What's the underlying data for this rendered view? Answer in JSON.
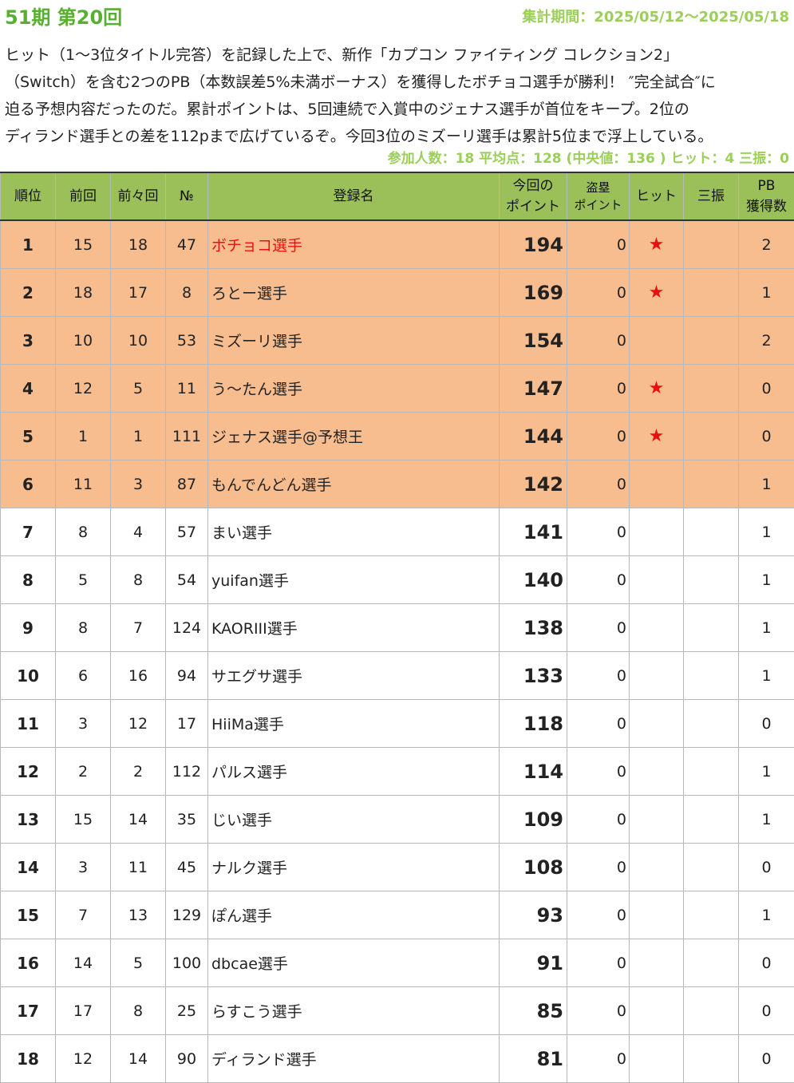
{
  "header": {
    "title": "51期 第20回",
    "period": "集計期間：2025/05/12～2025/05/18"
  },
  "description": "ヒット（1～3位タイトル完答）を記録した上で、新作「カプコン ファイティング コレクション2」\n（Switch）を含む2つのPB（本数誤差5%未満ボーナス）を獲得したボチョコ選手が勝利！ ″完全試合″に\n迫る予想内容だったのだ。累計ポイントは、5回連続で入賞中のジェナス選手が首位をキープ。2位の\nディランド選手との差を112pまで広げているぞ。今回3位のミズーリ選手は累計5位まで浮上している。",
  "stats": "参加人数：18 平均点：128 (中央値：136 ) ヒット：4 三振：0",
  "table": {
    "headers": {
      "rank": "順位",
      "prev": "前回",
      "prev2": "前々回",
      "no": "№",
      "name": "登録名",
      "points_line1": "今回の",
      "points_line2": "ポイント",
      "steal_line1": "盗塁",
      "steal_line2": "ポイント",
      "hit": "ヒット",
      "strikeout": "三振",
      "pb_line1": "PB",
      "pb_line2": "獲得数"
    },
    "hit_mark": "★",
    "highlight_color": "#f8bd8e",
    "header_color": "#9bc05a",
    "rows": [
      {
        "rank": "1",
        "prev": "15",
        "prev2": "18",
        "no": "47",
        "name": "ボチョコ選手",
        "points": "194",
        "steal": "0",
        "hit": "★",
        "strikeout": "",
        "pb": "2"
      },
      {
        "rank": "2",
        "prev": "18",
        "prev2": "17",
        "no": "8",
        "name": "ろとー選手",
        "points": "169",
        "steal": "0",
        "hit": "★",
        "strikeout": "",
        "pb": "1"
      },
      {
        "rank": "3",
        "prev": "10",
        "prev2": "10",
        "no": "53",
        "name": "ミズーリ選手",
        "points": "154",
        "steal": "0",
        "hit": "",
        "strikeout": "",
        "pb": "2"
      },
      {
        "rank": "4",
        "prev": "12",
        "prev2": "5",
        "no": "11",
        "name": "う～たん選手",
        "points": "147",
        "steal": "0",
        "hit": "★",
        "strikeout": "",
        "pb": "0"
      },
      {
        "rank": "5",
        "prev": "1",
        "prev2": "1",
        "no": "111",
        "name": "ジェナス選手@予想王",
        "points": "144",
        "steal": "0",
        "hit": "★",
        "strikeout": "",
        "pb": "0"
      },
      {
        "rank": "6",
        "prev": "11",
        "prev2": "3",
        "no": "87",
        "name": "もんでんどん選手",
        "points": "142",
        "steal": "0",
        "hit": "",
        "strikeout": "",
        "pb": "1"
      },
      {
        "rank": "7",
        "prev": "8",
        "prev2": "4",
        "no": "57",
        "name": "まい選手",
        "points": "141",
        "steal": "0",
        "hit": "",
        "strikeout": "",
        "pb": "1"
      },
      {
        "rank": "8",
        "prev": "5",
        "prev2": "8",
        "no": "54",
        "name": "yuifan選手",
        "points": "140",
        "steal": "0",
        "hit": "",
        "strikeout": "",
        "pb": "1"
      },
      {
        "rank": "9",
        "prev": "8",
        "prev2": "7",
        "no": "124",
        "name": "KAORIII選手",
        "points": "138",
        "steal": "0",
        "hit": "",
        "strikeout": "",
        "pb": "1"
      },
      {
        "rank": "10",
        "prev": "6",
        "prev2": "16",
        "no": "94",
        "name": "サエグサ選手",
        "points": "133",
        "steal": "0",
        "hit": "",
        "strikeout": "",
        "pb": "1"
      },
      {
        "rank": "11",
        "prev": "3",
        "prev2": "12",
        "no": "17",
        "name": "HiiMa選手",
        "points": "118",
        "steal": "0",
        "hit": "",
        "strikeout": "",
        "pb": "0"
      },
      {
        "rank": "12",
        "prev": "2",
        "prev2": "2",
        "no": "112",
        "name": "パルス選手",
        "points": "114",
        "steal": "0",
        "hit": "",
        "strikeout": "",
        "pb": "1"
      },
      {
        "rank": "13",
        "prev": "15",
        "prev2": "14",
        "no": "35",
        "name": "じい選手",
        "points": "109",
        "steal": "0",
        "hit": "",
        "strikeout": "",
        "pb": "1"
      },
      {
        "rank": "14",
        "prev": "3",
        "prev2": "11",
        "no": "45",
        "name": "ナルク選手",
        "points": "108",
        "steal": "0",
        "hit": "",
        "strikeout": "",
        "pb": "0"
      },
      {
        "rank": "15",
        "prev": "7",
        "prev2": "13",
        "no": "129",
        "name": "ぽん選手",
        "points": "93",
        "steal": "0",
        "hit": "",
        "strikeout": "",
        "pb": "1"
      },
      {
        "rank": "16",
        "prev": "14",
        "prev2": "5",
        "no": "100",
        "name": "dbcae選手",
        "points": "91",
        "steal": "0",
        "hit": "",
        "strikeout": "",
        "pb": "0"
      },
      {
        "rank": "17",
        "prev": "17",
        "prev2": "8",
        "no": "25",
        "name": "らすこう選手",
        "points": "85",
        "steal": "0",
        "hit": "",
        "strikeout": "",
        "pb": "0"
      },
      {
        "rank": "18",
        "prev": "12",
        "prev2": "14",
        "no": "90",
        "name": "ディランド選手",
        "points": "81",
        "steal": "0",
        "hit": "",
        "strikeout": "",
        "pb": "0"
      }
    ]
  }
}
